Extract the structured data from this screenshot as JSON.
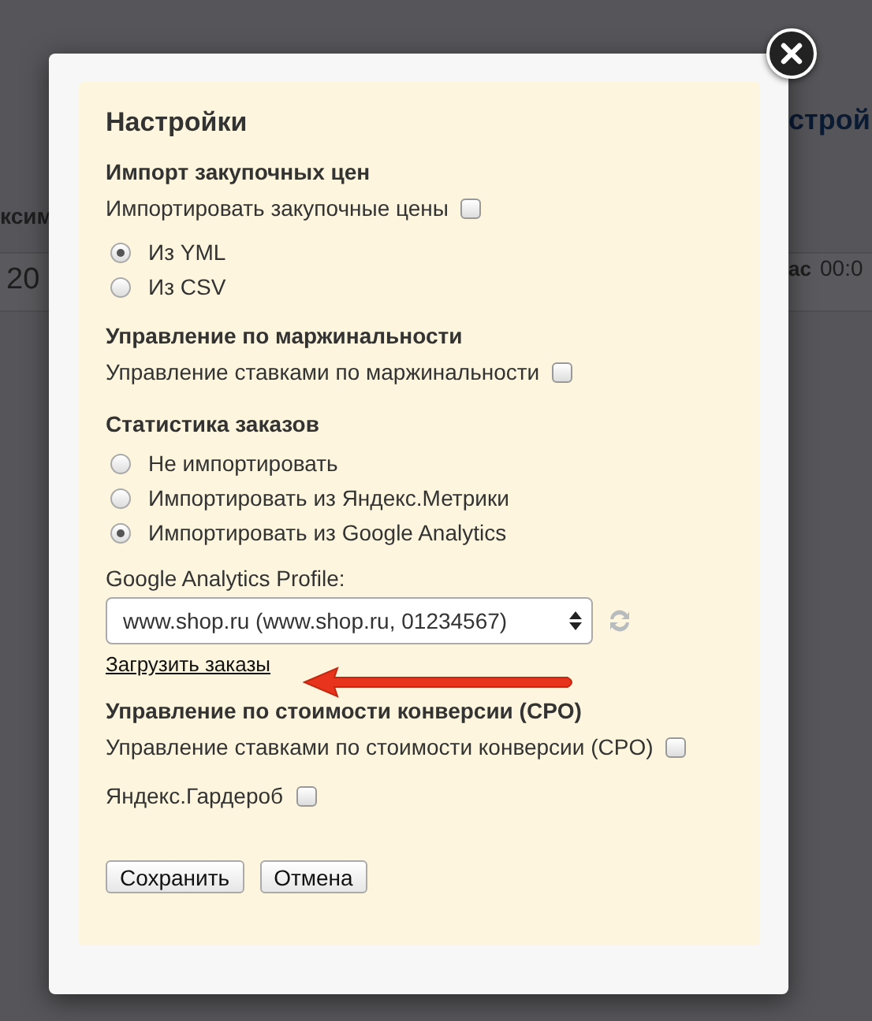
{
  "background": {
    "texts": [
      "ксим",
      "20",
      "строй",
      "ас",
      "00:0"
    ]
  },
  "dialog": {
    "title": "Настройки",
    "items": [
      {
        "kind": "heading",
        "text": "Импорт закупочных цен"
      },
      {
        "kind": "checkbox",
        "text": "Импортировать закупочные цены",
        "checked": false
      },
      {
        "kind": "radio",
        "text": "Из YML",
        "selected": true
      },
      {
        "kind": "radio",
        "text": "Из CSV",
        "selected": false
      },
      {
        "kind": "heading",
        "text": "Управление по маржинальности"
      },
      {
        "kind": "checkbox",
        "text": "Управление ставками по маржинальности",
        "checked": false
      },
      {
        "kind": "heading",
        "text": "Статистика заказов"
      },
      {
        "kind": "radio",
        "text": "Не импортировать",
        "selected": false
      },
      {
        "kind": "radio",
        "text": "Импортировать из Яндекс.Метрики",
        "selected": false
      },
      {
        "kind": "radio",
        "text": "Импортировать из Google Analytics",
        "selected": true
      },
      {
        "kind": "label",
        "text": "Google Analytics Profile:"
      },
      {
        "kind": "select",
        "value": "www.shop.ru (www.shop.ru, 01234567)"
      },
      {
        "kind": "link",
        "text": "Загрузить заказы"
      },
      {
        "kind": "heading",
        "text": "Управление по стоимости конверсии (CPO)"
      },
      {
        "kind": "checkbox",
        "text": "Управление ставками по стоимости конверсии (CPO)",
        "checked": false
      },
      {
        "kind": "checkbox",
        "text": "Яндекс.Гардероб",
        "checked": false
      }
    ],
    "buttons": [
      "Сохранить",
      "Отмена"
    ]
  }
}
